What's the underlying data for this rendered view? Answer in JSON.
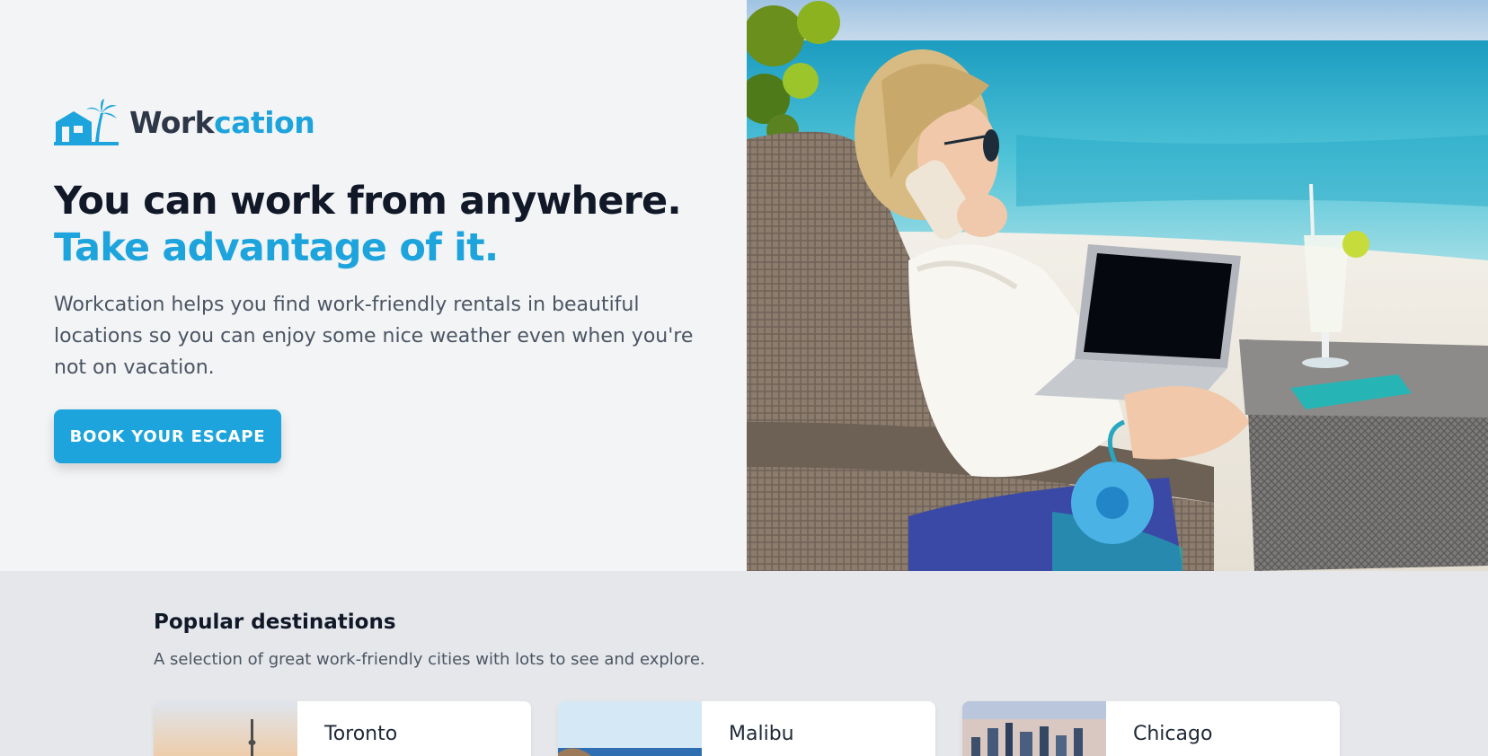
{
  "brand": {
    "name_prefix": "Work",
    "name_suffix": "cation",
    "logo_icon": "house-with-palm-tree-icon"
  },
  "hero": {
    "headline": "You can work from anywhere.",
    "headline_accent": "Take advantage of it.",
    "description": "Workcation helps you find work-friendly rentals in beautiful locations so you can enjoy some nice weather even when you're not on vacation.",
    "cta_label": "BOOK YOUR ESCAPE",
    "image_alt": "Woman working on a laptop on a beach"
  },
  "destinations": {
    "title": "Popular destinations",
    "subtitle": "A selection of great work-friendly cities with lots to see and explore.",
    "cards": [
      {
        "name": "Toronto"
      },
      {
        "name": "Malibu"
      },
      {
        "name": "Chicago"
      }
    ]
  },
  "colors": {
    "brand_blue": "#1ea4dc",
    "dark_text": "#111827",
    "body_text": "#4b5563",
    "hero_bg": "#f3f4f6",
    "section_bg": "#e5e7eb"
  }
}
